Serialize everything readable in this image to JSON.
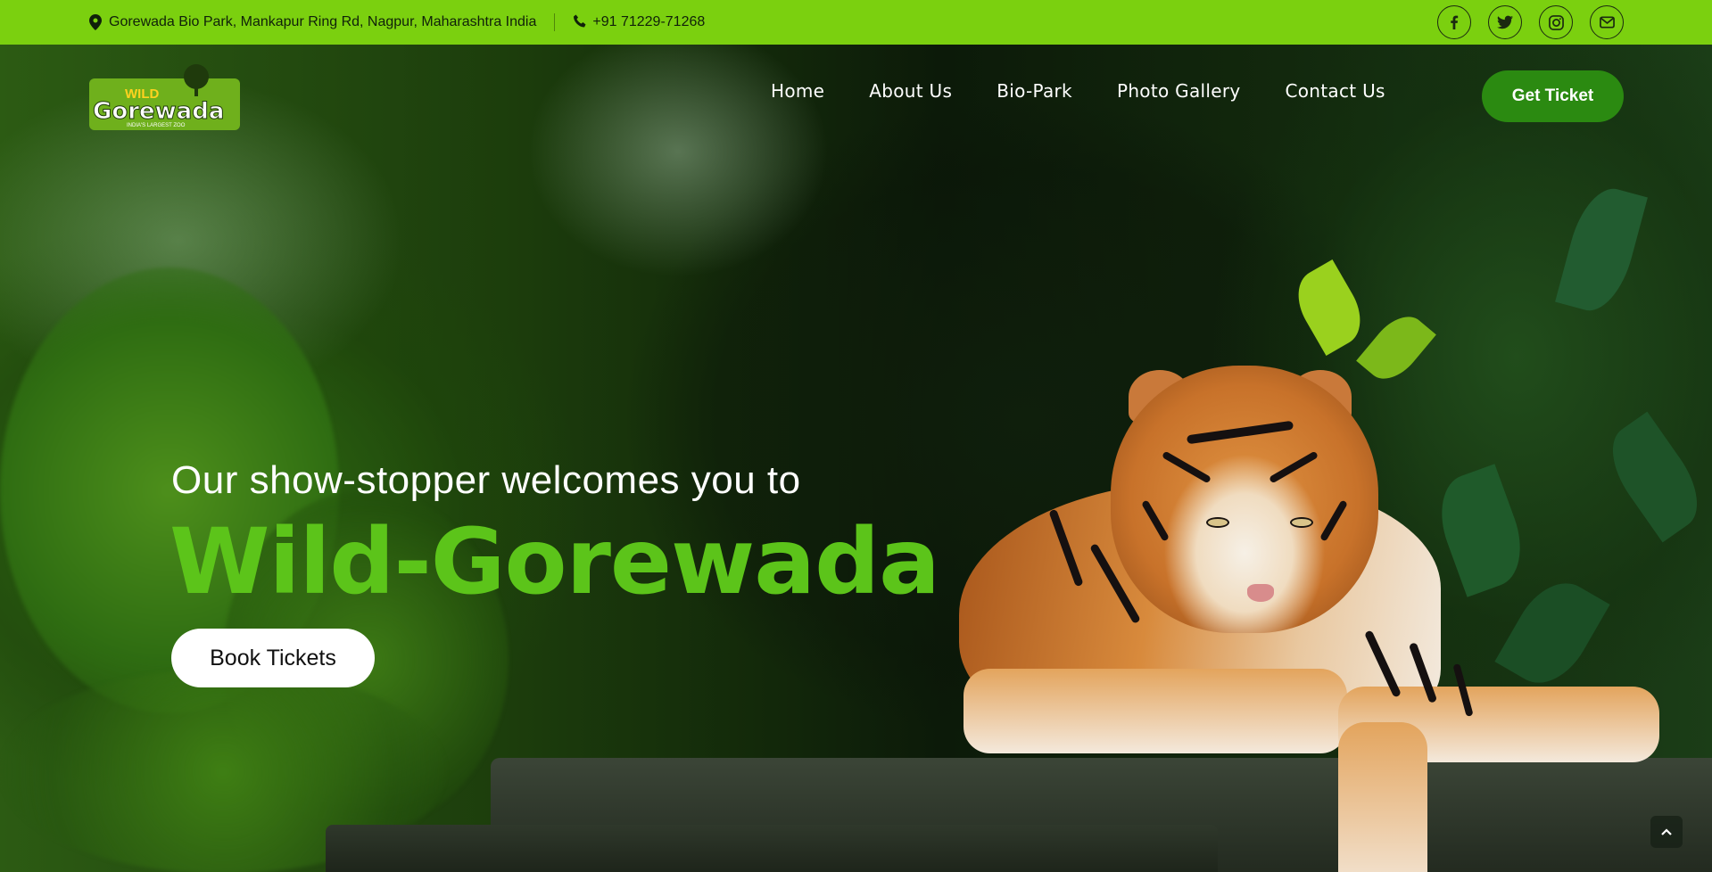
{
  "topbar": {
    "address": "Gorewada Bio Park, Mankapur Ring Rd, Nagpur, Maharashtra India",
    "phone": "+91 71229-71268",
    "socials": [
      {
        "icon": "facebook-icon"
      },
      {
        "icon": "twitter-icon"
      },
      {
        "icon": "instagram-icon"
      },
      {
        "icon": "envelope-icon"
      }
    ],
    "color": "#7bd00f"
  },
  "logo": {
    "line1": "WILD",
    "line2": "Gorewada",
    "tagline": "INDIA'S LARGEST ZOO"
  },
  "nav": {
    "items": [
      "Home",
      "About Us",
      "Bio-Park",
      "Photo Gallery",
      "Contact Us"
    ],
    "cta": "Get Ticket"
  },
  "hero": {
    "subtitle": "Our show-stopper welcomes you to",
    "title": "Wild-Gorewada",
    "button": "Book Tickets",
    "accent_color": "#5cc41a",
    "button_color": "#2b8a11"
  }
}
